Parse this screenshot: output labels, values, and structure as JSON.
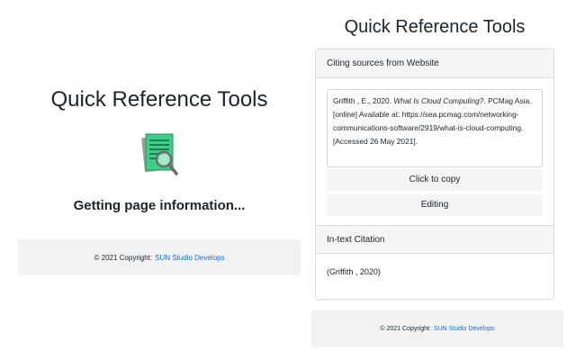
{
  "left": {
    "title": "Quick Reference Tools",
    "status": "Getting page information...",
    "icon": "document-magnifier-icon"
  },
  "right": {
    "title": "Quick Reference Tools",
    "sources_header": "Citing sources from Website",
    "citation": {
      "before": "Griffith , E., 2020. ",
      "italic": "What Is Cloud Computing?",
      "after": ". PCMag Asia. [online] Available at: https://sea.pcmag.com/networking-communications-software/2919/what-is-cloud-computing. [Accessed 26 May 2021]."
    },
    "copy_label": "Click to copy",
    "editing_label": "Editing",
    "intext_header": "In-text Citation",
    "intext_value": "(Griffith , 2020)"
  },
  "footer": {
    "text": "© 2021 Copyright:",
    "link": "SUN Studio Develops"
  },
  "colors": {
    "link": "#0d6efd",
    "panel_bg": "#f2f2f2",
    "icon_green": "#3ccf86"
  }
}
